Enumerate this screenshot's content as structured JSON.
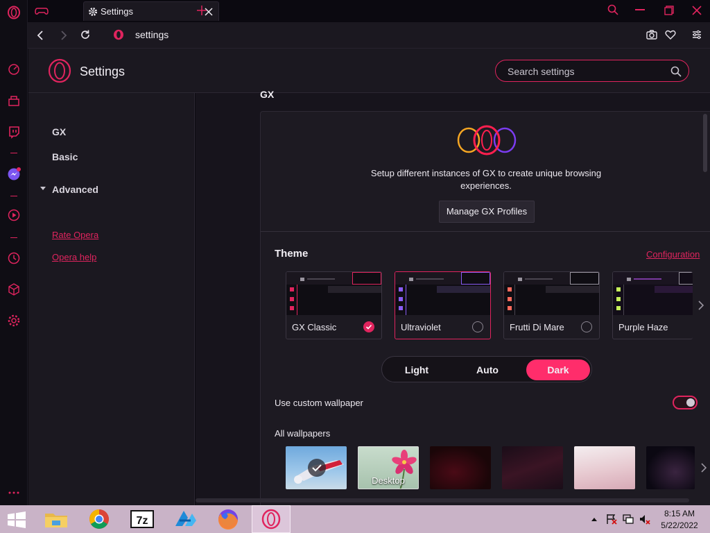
{
  "tab": {
    "title": "Settings"
  },
  "address": {
    "text": "settings"
  },
  "header": {
    "title": "Settings",
    "search_placeholder": "Search settings"
  },
  "nav": {
    "items": [
      "GX",
      "Basic",
      "Advanced"
    ],
    "links": [
      "Rate Opera",
      "Opera help"
    ]
  },
  "gx": {
    "heading": "GX",
    "profiles_text": "Setup different instances of GX to create unique browsing experiences.",
    "manage_button": "Manage GX Profiles"
  },
  "theme": {
    "title": "Theme",
    "config_link": "Configuration",
    "options": [
      {
        "name": "GX Classic",
        "checked": true,
        "accent": "#e0245e"
      },
      {
        "name": "Ultraviolet",
        "checked": false,
        "accent": "#8a5cf5"
      },
      {
        "name": "Frutti Di Mare",
        "checked": false,
        "accent": "#ff6a5c"
      },
      {
        "name": "Purple Haze",
        "checked": false,
        "accent": "#c6f05a"
      }
    ],
    "modes": [
      "Light",
      "Auto",
      "Dark"
    ],
    "active_mode": "Dark"
  },
  "wallpaper": {
    "custom_label": "Use custom wallpaper",
    "custom_enabled": true,
    "all_label": "All wallpapers",
    "items": [
      {
        "caption": "",
        "selected": true
      },
      {
        "caption": "Desktop",
        "selected": false
      },
      {
        "caption": "",
        "selected": false
      },
      {
        "caption": "",
        "selected": false
      },
      {
        "caption": "",
        "selected": false
      },
      {
        "caption": "",
        "selected": false
      }
    ]
  },
  "taskbar": {
    "apps": [
      "file-explorer",
      "chrome",
      "7zip",
      "app-4",
      "firefox",
      "opera-gx"
    ],
    "time": "8:15 AM",
    "date": "5/22/2022"
  },
  "colors": {
    "accent": "#e0245e",
    "background": "#1b1820"
  }
}
